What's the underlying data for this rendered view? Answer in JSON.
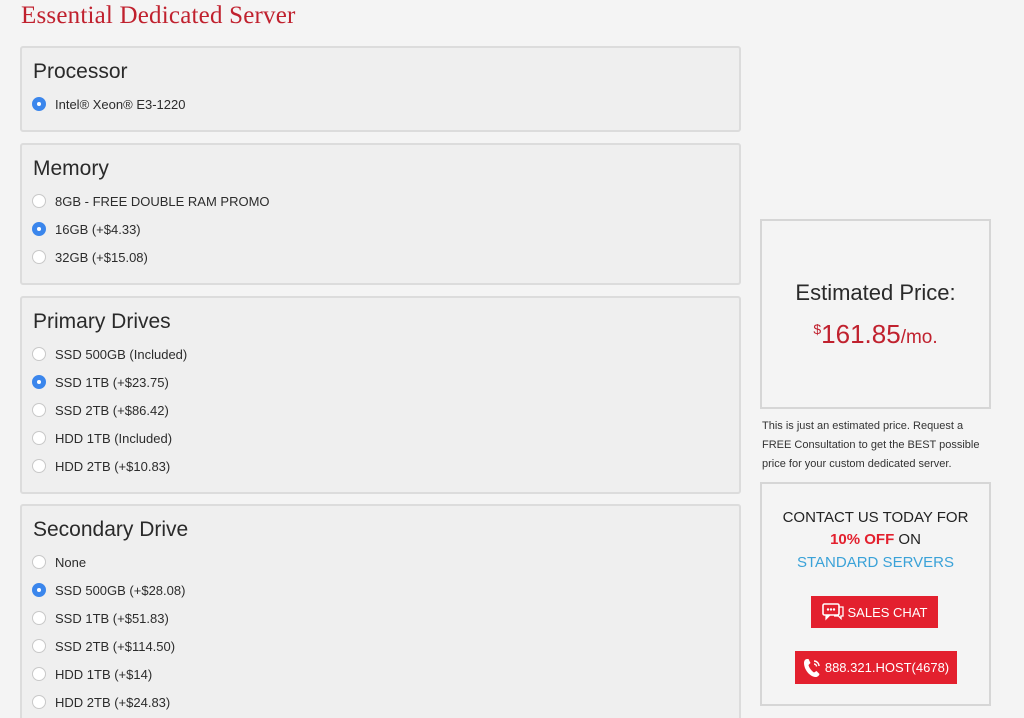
{
  "page": {
    "title": "Essential Dedicated Server"
  },
  "sections": {
    "processor": {
      "title": "Processor",
      "options": [
        {
          "label": "Intel® Xeon® E3-1220",
          "selected": true
        }
      ]
    },
    "memory": {
      "title": "Memory",
      "options": [
        {
          "label": "8GB - FREE DOUBLE RAM PROMO",
          "selected": false
        },
        {
          "label": "16GB (+$4.33)",
          "selected": true
        },
        {
          "label": "32GB (+$15.08)",
          "selected": false
        }
      ]
    },
    "primary_drives": {
      "title": "Primary Drives",
      "options": [
        {
          "label": "SSD 500GB (Included)",
          "selected": false
        },
        {
          "label": "SSD 1TB (+$23.75)",
          "selected": true
        },
        {
          "label": "SSD 2TB (+$86.42)",
          "selected": false
        },
        {
          "label": "HDD 1TB (Included)",
          "selected": false
        },
        {
          "label": "HDD 2TB (+$10.83)",
          "selected": false
        }
      ]
    },
    "secondary_drive": {
      "title": "Secondary Drive",
      "options": [
        {
          "label": "None",
          "selected": false
        },
        {
          "label": "SSD 500GB (+$28.08)",
          "selected": true
        },
        {
          "label": "SSD 1TB (+$51.83)",
          "selected": false
        },
        {
          "label": "SSD 2TB (+$114.50)",
          "selected": false
        },
        {
          "label": "HDD 1TB (+$14)",
          "selected": false
        },
        {
          "label": "HDD 2TB (+$24.83)",
          "selected": false
        }
      ]
    }
  },
  "price": {
    "label": "Estimated Price:",
    "currency": "$",
    "amount": "161.85",
    "period": "/mo."
  },
  "disclaimer": "This is just an estimated price. Request a FREE Consultation to get the BEST possible price for your custom dedicated server.",
  "contact": {
    "line1": "CONTACT US TODAY FOR",
    "highlight": "10% OFF",
    "line2_rest": " ON",
    "line3": "STANDARD SERVERS",
    "chat_label": "SALES CHAT",
    "phone_label": "888.321.HOST(4678)"
  },
  "colors": {
    "brand_red": "#c0212e",
    "button_red": "#e3202e",
    "radio_blue": "#3b86ec",
    "link_blue": "#3aa2d8"
  },
  "icons": {
    "chat": "chat-bubble-icon",
    "phone": "phone-icon"
  }
}
